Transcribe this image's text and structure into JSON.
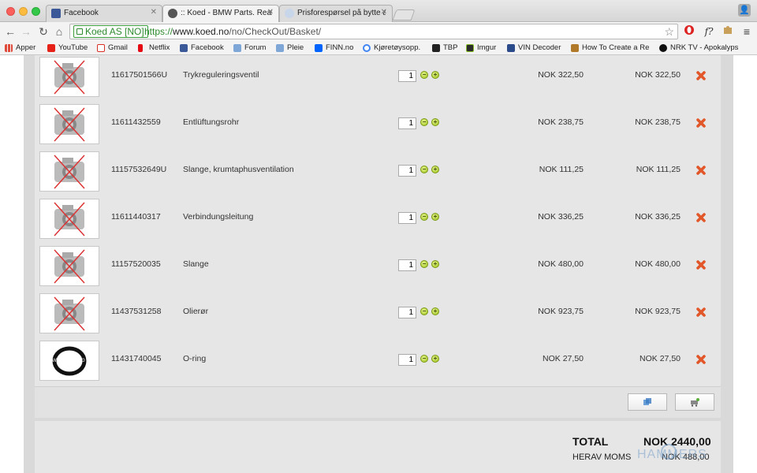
{
  "tabs": [
    {
      "title": "Facebook",
      "color": "#3b5998"
    },
    {
      "title": ":: Koed - BMW Parts. Real",
      "color": "#444444"
    },
    {
      "title": "Prisforespørsel på bytte av",
      "color": "#8aa4c8"
    }
  ],
  "toolbar": {
    "ev_label": "Koed AS [NO]",
    "url_scheme": "https://",
    "url_host": "www.koed.no",
    "url_path": "/no/CheckOut/Basket/",
    "ext_f": "f?"
  },
  "bookmarks": [
    {
      "label": "Apper",
      "color": "#e04a3a"
    },
    {
      "label": "YouTube",
      "color": "#e62117"
    },
    {
      "label": "Gmail",
      "color": "#d93025"
    },
    {
      "label": "Netflix",
      "color": "#e50914"
    },
    {
      "label": "Facebook",
      "color": "#3b5998"
    },
    {
      "label": "Forum",
      "color": "#7ea7d8"
    },
    {
      "label": "Pleie",
      "color": "#7ea7d8"
    },
    {
      "label": "FINN.no",
      "color": "#0063fb"
    },
    {
      "label": "Kjøretøysopp.",
      "color": "#4285f4"
    },
    {
      "label": "TBP",
      "color": "#222222"
    },
    {
      "label": "Imgur",
      "color": "#2b2b2b"
    },
    {
      "label": "VIN Decoder",
      "color": "#2a4a8a"
    },
    {
      "label": "How To Create a Re",
      "color": "#b07a2a"
    },
    {
      "label": "NRK TV - Apokalyps",
      "color": "#111111"
    }
  ],
  "items": [
    {
      "part": "11617501566U",
      "desc": "Trykreguleringsventil",
      "qty": "1",
      "price": "NOK 322,50",
      "total": "NOK 322,50",
      "image": "no-image"
    },
    {
      "part": "11611432559",
      "desc": "Entlüftungsrohr",
      "qty": "1",
      "price": "NOK 238,75",
      "total": "NOK 238,75",
      "image": "no-image"
    },
    {
      "part": "11157532649U",
      "desc": "Slange, krumtaphusventilation",
      "qty": "1",
      "price": "NOK 111,25",
      "total": "NOK 111,25",
      "image": "no-image"
    },
    {
      "part": "11611440317",
      "desc": "Verbindungsleitung",
      "qty": "1",
      "price": "NOK 336,25",
      "total": "NOK 336,25",
      "image": "no-image"
    },
    {
      "part": "11157520035",
      "desc": "Slange",
      "qty": "1",
      "price": "NOK 480,00",
      "total": "NOK 480,00",
      "image": "no-image"
    },
    {
      "part": "11437531258",
      "desc": "Olierør",
      "qty": "1",
      "price": "NOK 923,75",
      "total": "NOK 923,75",
      "image": "no-image"
    },
    {
      "part": "11431740045",
      "desc": "O-ring",
      "qty": "1",
      "price": "NOK 27,50",
      "total": "NOK 27,50",
      "image": "o-ring",
      "watermark": "© www.koed.no"
    }
  ],
  "totals": {
    "total_label": "TOTAL",
    "total_value": "NOK 2440,00",
    "moms_label": "HERAV MOMS",
    "moms_value": "NOK 488,00"
  },
  "watermark": "HAMMERS"
}
